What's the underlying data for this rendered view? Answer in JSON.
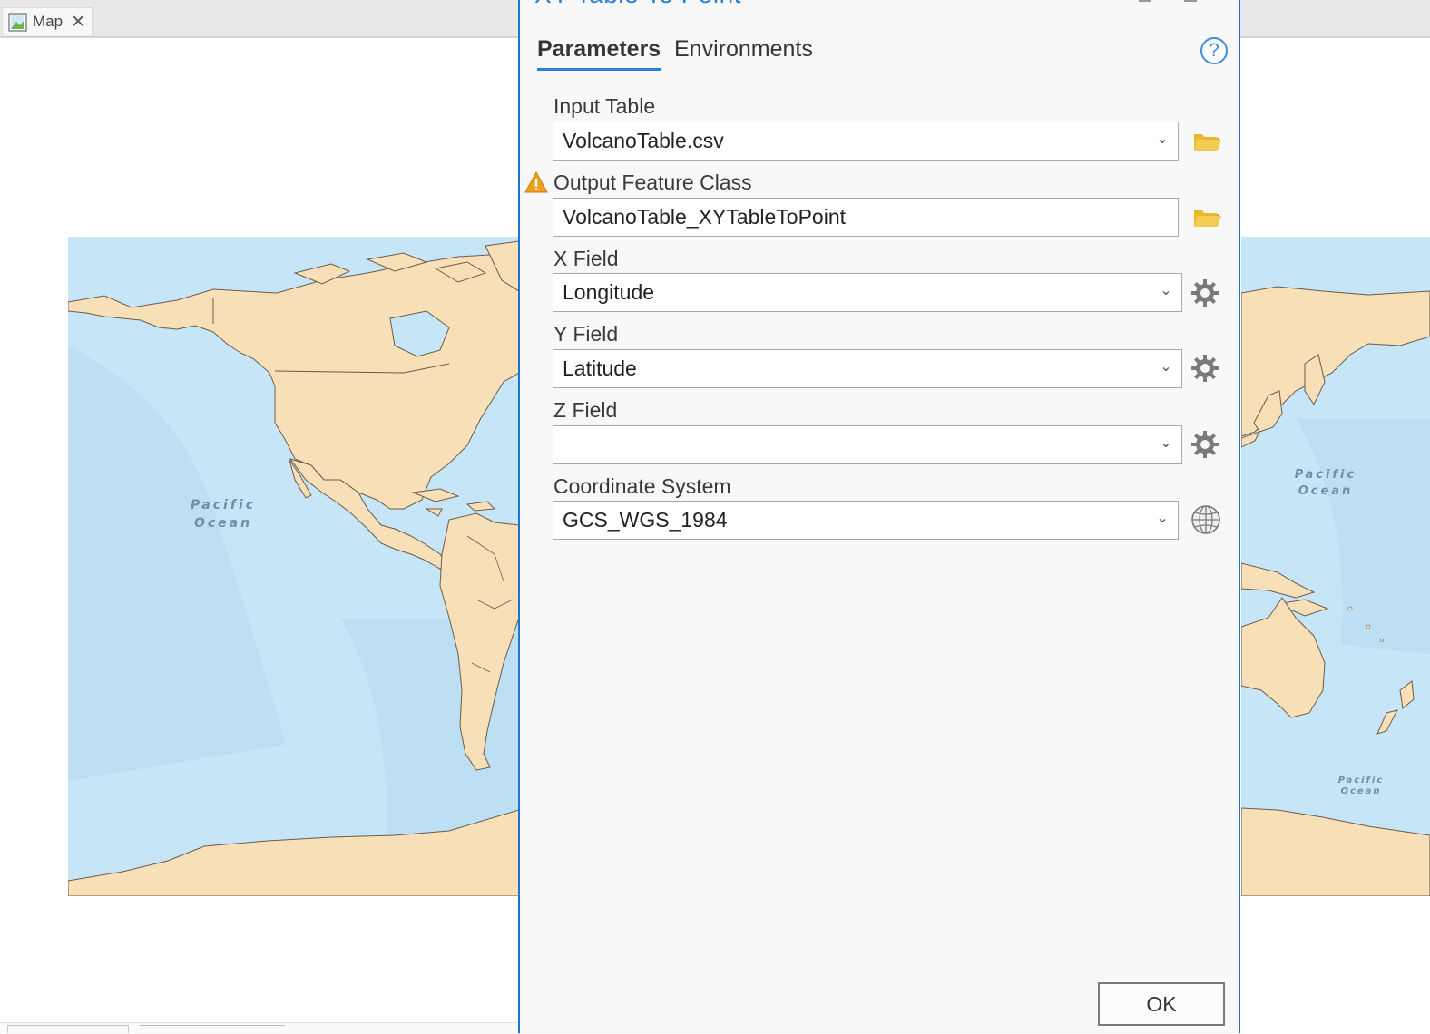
{
  "document_tab": {
    "label": "Map",
    "close_glyph": "✕",
    "icon": "map-document-icon"
  },
  "map": {
    "left_ocean_label_line1": "Pacific",
    "left_ocean_label_line2": "Ocean",
    "right_ocean_label_line1": "Pacific",
    "right_ocean_label_line2": "Ocean",
    "right_lower_ocean_label_line1": "Pacific",
    "right_lower_ocean_label_line2": "Ocean",
    "colors": {
      "ocean": "#c6e6f8",
      "land": "#f7dfb8",
      "border": "#6e5b4a"
    }
  },
  "geoprocessing": {
    "title": "XY Table To Point",
    "tabs": [
      {
        "label": "Parameters",
        "active": true
      },
      {
        "label": "Environments",
        "active": false
      }
    ],
    "help_glyph": "?",
    "parameters": [
      {
        "label": "Input Table",
        "value": "VolcanoTable.csv",
        "control": "dropdown",
        "side_icon": "folder-icon",
        "warning": false
      },
      {
        "label": "Output Feature Class",
        "value": "VolcanoTable_XYTableToPoint",
        "control": "text",
        "side_icon": "folder-icon",
        "warning": true
      },
      {
        "label": "X Field",
        "value": "Longitude",
        "control": "dropdown",
        "side_icon": "gear-icon",
        "warning": false
      },
      {
        "label": "Y Field",
        "value": "Latitude",
        "control": "dropdown",
        "side_icon": "gear-icon",
        "warning": false
      },
      {
        "label": "Z Field",
        "value": "",
        "control": "dropdown",
        "side_icon": "gear-icon",
        "warning": false
      },
      {
        "label": "Coordinate System",
        "value": "GCS_WGS_1984",
        "control": "dropdown",
        "side_icon": "globe-icon",
        "warning": false
      }
    ],
    "dropdown_glyph": "⌄",
    "ok_label": "OK",
    "colors": {
      "accent": "#2a7fd4",
      "folder": "#e8b930",
      "warning": "#f0a020"
    }
  }
}
